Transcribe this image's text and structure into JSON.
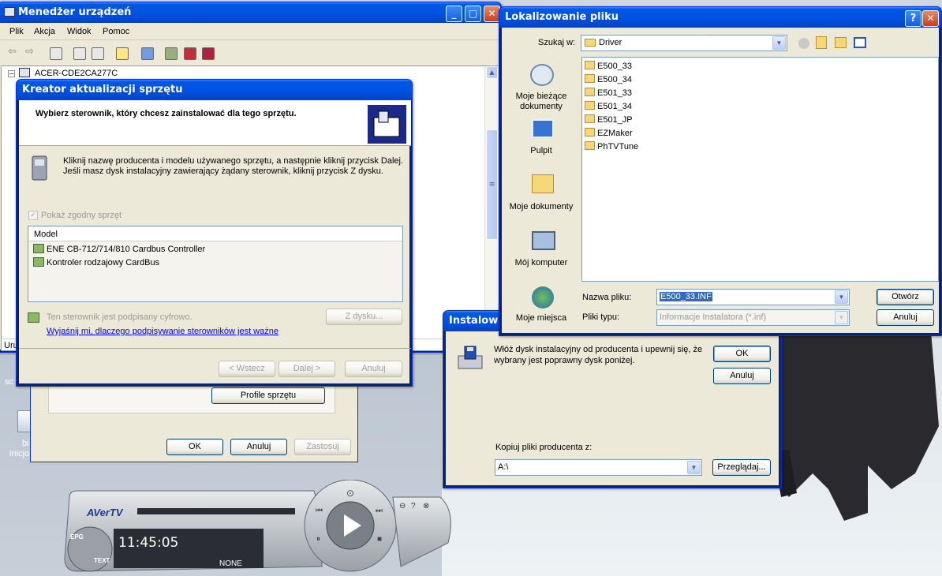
{
  "device_manager": {
    "title": "Menedżer urządzeń",
    "menu": [
      "Plik",
      "Akcja",
      "Widok",
      "Pomoc"
    ],
    "tree_root": "ACER-CDE2CA277C",
    "status_left": "Uru"
  },
  "properties_dialog": {
    "profiles_button": "Profile sprzętu",
    "ok": "OK",
    "cancel": "Anuluj",
    "apply": "Zastosuj"
  },
  "wizard": {
    "title": "Kreator aktualizacji sprzętu",
    "header": "Wybierz sterownik, który chcesz zainstalować dla tego sprzętu.",
    "instruction_line1": "Kliknij nazwę producenta i modelu używanego sprzętu, a następnie kliknij przycisk Dalej.",
    "instruction_line2": "Jeśli masz dysk instalacyjny zawierający żądany sterownik, kliknij przycisk Z dysku.",
    "show_compatible": "Pokaż zgodny sprzęt",
    "list_header": "Model",
    "models": [
      "ENE CB-712/714/810 Cardbus Controller",
      "Kontroler rodzajowy CardBus"
    ],
    "signed_text": "Ten sterownik jest podpisany cyfrowo.",
    "signing_link": "Wyjaśnij mi, dlaczego podpisywanie sterowników jest ważne",
    "have_disk": "Z dysku...",
    "back": "< Wstecz",
    "next": "Dalej >",
    "cancel": "Anuluj"
  },
  "install_disk": {
    "title": "Instalowan",
    "message_line1": "Włóż dysk instalacyjny od producenta i upewnij się, że",
    "message_line2": "wybrany jest poprawny dysk poniżej.",
    "ok": "OK",
    "cancel": "Anuluj",
    "copy_label": "Kopiuj pliki producenta z:",
    "copy_value": "A:\\",
    "browse": "Przeglądaj..."
  },
  "locate_file": {
    "title": "Lokalizowanie pliku",
    "look_in_label": "Szukaj w:",
    "look_in_value": "Driver",
    "places": [
      "Moje bieżące dokumenty",
      "Pulpit",
      "Moje dokumenty",
      "Mój komputer",
      "Moje miejsca"
    ],
    "files": [
      "E500_33",
      "E500_34",
      "E501_33",
      "E501_34",
      "E501_JP",
      "EZMaker",
      "PhTVTune"
    ],
    "filename_label": "Nazwa pliku:",
    "filename_value": "E500_33.INF",
    "filetype_label": "Pliki typu:",
    "filetype_value": "Informacje Instalatora (*.inf)",
    "open": "Otwórz",
    "cancel": "Anuluj"
  },
  "desktop": {
    "icon_label_1": "bi",
    "icon_label_2": "inicjo",
    "sc_label": "sc"
  },
  "avertv": {
    "logo": "AVerTV",
    "time": "11:45:05",
    "channel": "NONE",
    "epg": "EPG",
    "text": "TEXT"
  },
  "colors": {
    "xp_title_blue": "#0054e3",
    "dialog_bg": "#ece9d8",
    "link_blue": "#0000ff",
    "avertv_body": "#c8ccd0"
  }
}
